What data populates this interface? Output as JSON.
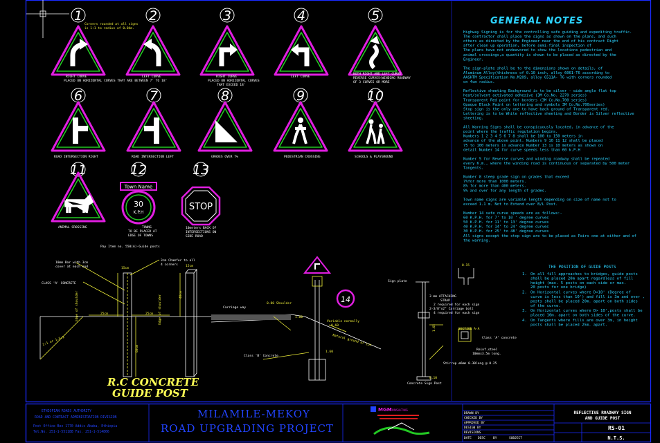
{
  "signs": [
    {
      "num": "1",
      "caption": "RIGHT CURVE",
      "icon": "right-curve-icon"
    },
    {
      "num": "2",
      "caption": "LEFT CURVE",
      "icon": "left-curve-icon"
    },
    {
      "num": "3",
      "caption": "RIGHT CURVE",
      "icon": "right-turn-icon"
    },
    {
      "num": "4",
      "caption": "LEFT CURVE",
      "icon": "left-turn-icon"
    },
    {
      "num": "5",
      "caption": "BOTH RIGHT AND LEFT CURVE",
      "icon": "double-curve-icon"
    },
    {
      "num": "6",
      "caption": "ROAD INTERSECTION RIGHT",
      "icon": "intersection-right-icon"
    },
    {
      "num": "7",
      "caption": "ROAD INTERSECTION LEFT",
      "icon": "intersection-left-icon"
    },
    {
      "num": "8",
      "caption": "GRADES OVER 7%",
      "icon": "grade-icon"
    },
    {
      "num": "9",
      "caption": "PEDESTRIAN CROSSING",
      "icon": "pedestrian-icon"
    },
    {
      "num": "10",
      "caption": "SCHOOLS & PLAYGROUND",
      "icon": "children-icon"
    },
    {
      "num": "11",
      "caption": "ANIMAL CROSSING",
      "icon": "animal-icon"
    },
    {
      "num": "12",
      "caption": "TOWNS",
      "icon": "speed-limit-icon"
    },
    {
      "num": "13",
      "caption": "10meters BACK OF",
      "icon": "stop-icon"
    }
  ],
  "notes": {
    "sign1_top": "Corners rounded at all signs",
    "sign1_top2": "is 1:1 to radius of 0.04m.",
    "row1_sub": "PLACED ON HORIZONTAL CURVES THAT ARE BETWEEN 7' TO 18'",
    "sign3_sub1": "PLACED ON HORIZONTAL CURVES",
    "sign3_sub2": "THAT EXCEED 18'",
    "sign5_sub1": "REVERSE CURVES(WINDING ROADWAY",
    "sign5_sub2": "OF 3 CURVES OR MORE",
    "sign12_sub1": "TO BE PLACED AT",
    "sign12_sub2": "EDGE OF TOWNS",
    "sign13_sub1": "INTERSECTIONS ON",
    "sign13_sub2": "SIDE ROAD",
    "town_name": "Town Name",
    "speed_value": "30",
    "speed_unit": "K.P.H",
    "stop_text": "STOP",
    "pay_item": "Pay Item no. 550(A)-Guide posts",
    "sign14_num": "14"
  },
  "general_notes": {
    "title": "GENERAL    NOTES",
    "lines": [
      "Highway Signing is for the controlling safe guiding and expediting traffic.",
      "The contractor shall place the signs as shown on the plans, and such",
      "others as directed by the Engineer near the end of his contract Right",
      "after clean up operation, before semi-final inspection of",
      "The plans have not endeavored to show the locations pedestrian and",
      "animal crossings,a quantity is shown to be placed as directed by the",
      "Engineer.",
      "",
      "The sign-plate shall be to the dimensions shown on details, of",
      "Aluminum Alloy(thickness of 0.10 inch, alloy 6061-T6 according to",
      "AASHTM Specification No.M209, alloy 6511A- T6 with corners rounded",
      "on 4cm radius.",
      "",
      "Reflective sheeting Background is to be silver - wide angle flat top",
      "heat/solvent activated adhesive (3M Co.No. 2270 series)",
      "Transparent Red paint for borders (3M  Co.No.700 series)",
      "Opaque Black Paint on lettering and symbols 3M Co.No.700series)",
      "Stop sign is the only one to have back ground of Transparent red.",
      "Lettering is to be White reflective sheeting and Border is Silver reflective",
      "sheeting.",
      "",
      "All Warning Signs shall be conspicuously located, in advance of the",
      "point where the traffic regulation begins.",
      "Numbers  1  2  3  4  5  6  7  8  shall be 100 to 150 meters in",
      "advance of the above point. Numbers  9  10  11  12  shall be placed",
      "75  to 100 meters in advance Number 13  is  10  meters as shown on",
      "detail  Number  14  for curve speeds less than 60 k.P.H",
      "",
      "Number    5  for Reverse curves and winding roadway shall be repeated",
      "every K.m., where the winding road is continuous or separated by 500 meter",
      "Tangents.",
      "",
      "Number  8  steep grade sign on grades that exceed",
      "7%for more than 1000 meters.",
      "8% for more than 400 meters.",
      "9% and over for any length of grades.",
      "",
      "Town name signs are variable length depending on size of name not to",
      "exceed 1.1 m. Not to Extend over B/L Post.",
      "",
      "Number  14   safe curve speeds are as follows:-",
      "              60 K.P.H. for 7' to 10 '  degree curves",
      "              50 K.P.H. for 11' to 13'  degree curves",
      "              40 K.P.H. for 14' to 24'  degree curves",
      "              30 K.P.H. for 25' to 48'  degree curves",
      "All signs except the stop sign are to be placed as Pairs one at either and of",
      "the warning."
    ]
  },
  "guide_posts": {
    "title": "THE POSITION OF GUIDE POSTS",
    "items": [
      {
        "n": "1.",
        "text": [
          "On all fill approaches to bridges, guide posts",
          "shall be placed 20m apart regardless of fill",
          "height (max. 5 posts on each side or max.",
          "20 posts for one bridge)"
        ]
      },
      {
        "n": "2.",
        "text": [
          "On Horizontal curves where D<10' (Degree of",
          "curve is less than 10') and fill is 3m and over ,",
          "posts shall be placed 20m. apart on both sides",
          "of the curve."
        ]
      },
      {
        "n": "3.",
        "text": [
          "On Horizontal curves where D> 10',posts shall be",
          "placed 10m. apart on both sides of the curve."
        ]
      },
      {
        "n": "4.",
        "text": [
          "On Tangents where fills are over 3m, in height",
          "posts shall be placed 25m. apart."
        ]
      }
    ]
  },
  "details": {
    "reinf_label": "10mm Bar with 3cm",
    "reinf_label2": "cover at each end",
    "chamfer_label": "3cm Chamfer to all",
    "chamfer_label2": "4 corners",
    "class_a": "CLASS 'A' CONCRETE",
    "dim_15": "15cm",
    "dim_15b": "15cm",
    "dim_40": "40cm",
    "dim_60": "60cm",
    "dim_25": "25cm",
    "dim_25b": "25cm",
    "slope": "2:1 or 1.5:1",
    "edge_shoulder": "Edge of shoulder",
    "carriage_way": "Carriage way",
    "shoulder": "0.80 Shoulder",
    "variable": "Variable normally",
    "variable2": "0.60",
    "grade_line": "Natural ground or cut",
    "class_b": "Class 'B' Concrete",
    "sign_plate": "Sign plate",
    "attaching": "3 mm ATTACHING",
    "strap": "STRAP",
    "req1": "2 required for each sign",
    "carriage_bolt": "2-3/8\"x2\" Carriage bolt",
    "req2": "4 required for each sign",
    "section": "SECTION A-A",
    "class_a2": "Class 'A' concrete",
    "reinf": "Reinf.steel",
    "reinf2": "10mmx3.5m long.",
    "stirrup": "Stirrup ø6mm 0.30long @ 0.25",
    "concrete_post": "Concrete Sign Post",
    "dim_010": "0.10",
    "dim_015": "0.15",
    "dim_165": "1.65",
    "dim_160": "1.60"
  },
  "rc_title1": "R.C CONCRETE",
  "rc_title2": "GUIDE POST",
  "title_block": {
    "client1": "ETHIOPIAN ROADS AUTHORITY",
    "client2": "ROAD AND CONTRACT ADMINISTRATION DIVISION",
    "client3": "Post Office Box 1770 Addis Ababa, Ethiopia",
    "client4": "Tel.No. 251-1-551188   Fax. 251-1-514866",
    "project1": "MILAMILE-MEKOY",
    "project2": "ROAD UPGRADING PROJECT",
    "consultant": "MGM",
    "consultant2": "CONSULTING",
    "rows": [
      "DRAWN BY",
      "CHECKED BY",
      "APPROVED BY",
      "DESIGN BY",
      "REVISIONS"
    ],
    "rev_cols": [
      "DATE",
      "DESC",
      "BY",
      "SUBJECT"
    ],
    "dwg_title1": "REFLECTIVE ROADWAY SIGN",
    "dwg_title2": "AND GUIDE POST",
    "dwg_no": "RS-01",
    "scale": "N.T.S."
  },
  "colors": {
    "border_blue": "#1a2bff",
    "magenta": "#e01ee0",
    "green": "#23c823",
    "yellow": "#f1f13a",
    "cyan": "#2cd3ff",
    "white": "#ffffff"
  }
}
